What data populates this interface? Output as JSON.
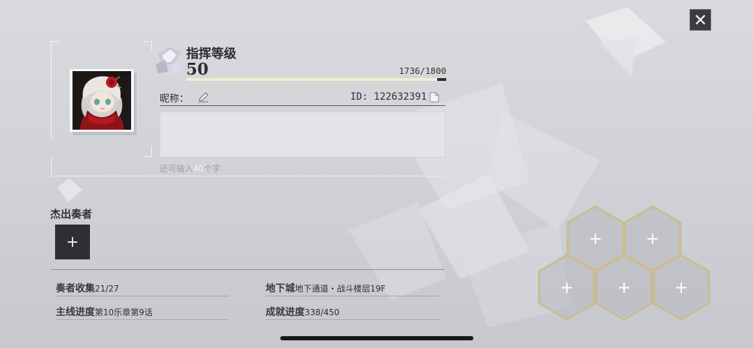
{
  "profile": {
    "title": "指挥等级",
    "level": "50",
    "exp_text": "1736/1800",
    "exp_fraction": 0.9644,
    "nickname_label": "昵称：",
    "id_text": "ID: 122632391",
    "signature_value": "",
    "hint_prefix": "还可输入",
    "hint_count": "40",
    "hint_suffix": "个字"
  },
  "players": {
    "title": "杰出奏者",
    "add_symbol": "+"
  },
  "stats": {
    "collection_label": "奏者收集",
    "collection_value": "21/27",
    "main_label": "主线进度",
    "main_value": "第10乐章第9话",
    "dungeon_label": "地下城",
    "dungeon_value": "地下通道・战斗楼层19F",
    "achievement_label": "成就进度",
    "achievement_value": "338/450"
  },
  "hex_slots": [
    "+",
    "+",
    "+",
    "+",
    "+"
  ],
  "close_symbol": "✕",
  "icons": {
    "close": "close-icon",
    "edit": "pencil-icon",
    "copy": "copy-icon",
    "rank": "crystal-icon"
  },
  "colors": {
    "exp_fill": "#eef0c8",
    "dark": "#2e2f34",
    "hex_gold": "#c9bd8f"
  }
}
